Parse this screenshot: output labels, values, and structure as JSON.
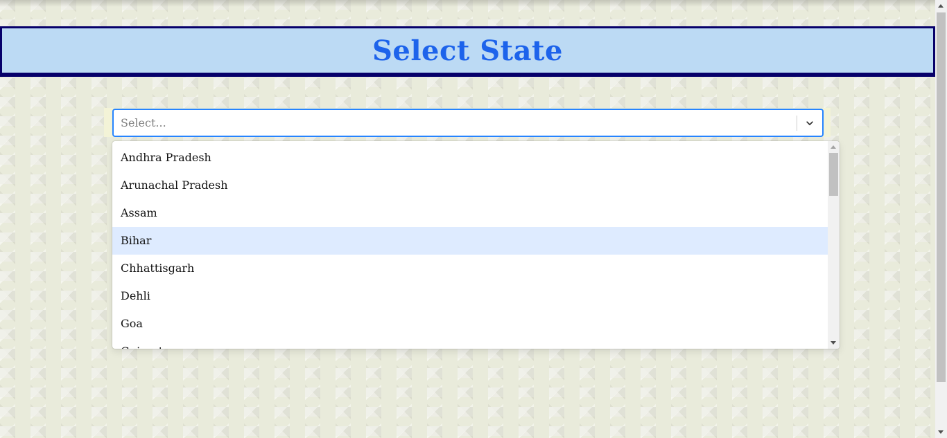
{
  "header": {
    "title": "Select State"
  },
  "select": {
    "placeholder": "Select...",
    "chevron_icon": "chevron-down-icon"
  },
  "menu": {
    "options": [
      "Andhra Pradesh",
      "Arunachal Pradesh",
      "Assam",
      "Bihar",
      "Chhattisgarh",
      "Dehli",
      "Goa",
      "Gujarat"
    ],
    "focused_option": "Bihar"
  },
  "colors": {
    "header_background": "#bcdaf4",
    "header_border": "#07006a",
    "title_color": "#1d63eb",
    "select_focus_border": "#2684ff",
    "option_focus_background": "#deebff"
  }
}
